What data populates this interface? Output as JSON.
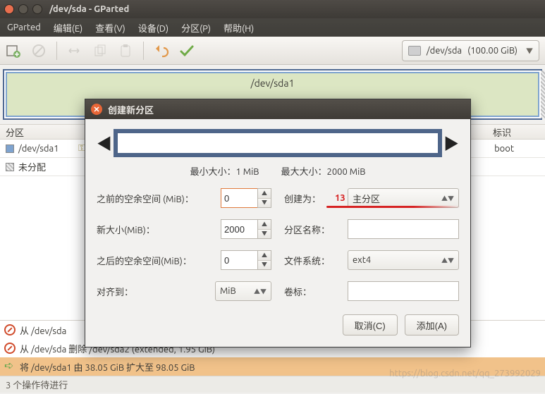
{
  "window": {
    "title": "/dev/sda - GParted"
  },
  "menu": {
    "gparted": "GParted",
    "edit": "编辑(E)",
    "view": "查看(V)",
    "device": "设备(D)",
    "partition": "分区(P)",
    "help": "帮助(H)"
  },
  "toolbar": {
    "device_path": "/dev/sda",
    "device_size": "(100.00 GiB)"
  },
  "diskmap": {
    "partition_label": "/dev/sda1"
  },
  "columns": {
    "partition": "分区",
    "flag": "标识"
  },
  "rows": {
    "p1": {
      "name": "/dev/sda1",
      "flag": "boot"
    },
    "unalloc": {
      "name": "未分配"
    }
  },
  "ops": {
    "o1": "从 /dev/sda ",
    "o2": "从 /dev/sda 删除 /dev/sda2 (extended, 1.95 GiB)",
    "o3": "将 /dev/sda1 由 38.05 GiB 扩大至 98.05 GiB"
  },
  "status": "3 个操作待进行",
  "watermark": "https://blog.csdn.net/qq_273992029",
  "dialog": {
    "title": "创建新分区",
    "min_label": "最小大小：",
    "min_val": "1 MiB",
    "max_label": "最大大小：",
    "max_val": "2000 MiB",
    "free_before": "之前的空余空间 (MiB)：",
    "free_before_val": "0",
    "new_size": "新大小(MiB)：",
    "new_size_val": "2000",
    "free_after": "之后的空余空间(MiB)：",
    "free_after_val": "0",
    "align": "对齐到：",
    "align_val": "MiB",
    "create_as": "创建为：",
    "create_as_val": "主分区",
    "part_name": "分区名称：",
    "fs": "文件系统：",
    "fs_val": "ext4",
    "label": "卷标：",
    "cancel": "取消(C)",
    "add": "添加(A)",
    "anno": "13"
  }
}
